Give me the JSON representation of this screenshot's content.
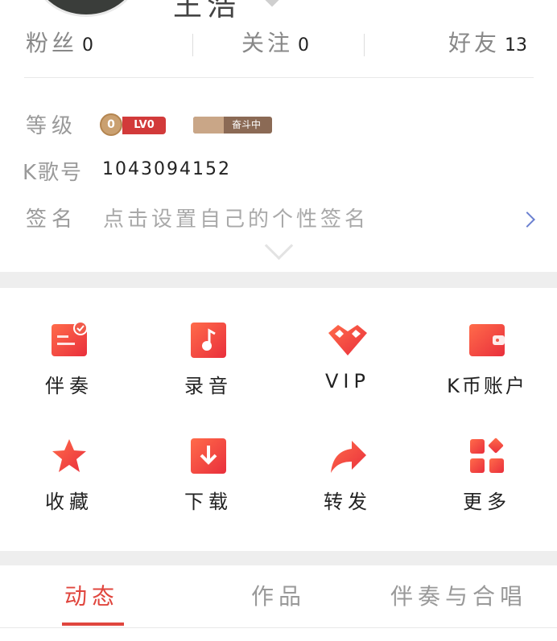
{
  "profile": {
    "name": "王浩"
  },
  "stats": [
    {
      "label": "粉丝",
      "value": "0"
    },
    {
      "label": "关注",
      "value": "0"
    },
    {
      "label": "好友",
      "value": "13"
    }
  ],
  "info": {
    "level_label": "等级",
    "level_coin": "0",
    "level_badge": "LV0",
    "rank_badge": "奋斗中",
    "id_label": "K歌号",
    "id_value": "1043094152",
    "sign_label": "签名",
    "sign_placeholder": "点击设置自己的个性签名"
  },
  "grid": [
    {
      "label": "伴奏",
      "icon": "accompaniment-icon"
    },
    {
      "label": "录音",
      "icon": "recording-icon"
    },
    {
      "label": "VIP",
      "icon": "vip-icon"
    },
    {
      "label": "K币账户",
      "icon": "wallet-icon"
    },
    {
      "label": "收藏",
      "icon": "star-icon"
    },
    {
      "label": "下载",
      "icon": "download-icon"
    },
    {
      "label": "转发",
      "icon": "share-icon"
    },
    {
      "label": "更多",
      "icon": "more-icon"
    }
  ],
  "tabs": [
    {
      "label": "动态",
      "active": true
    },
    {
      "label": "作品",
      "active": false
    },
    {
      "label": "伴奏与合唱",
      "active": false
    }
  ],
  "colors": {
    "accent": "#e0463e",
    "icon_gradient_start": "#ff6b4a",
    "icon_gradient_end": "#e92f3c"
  }
}
